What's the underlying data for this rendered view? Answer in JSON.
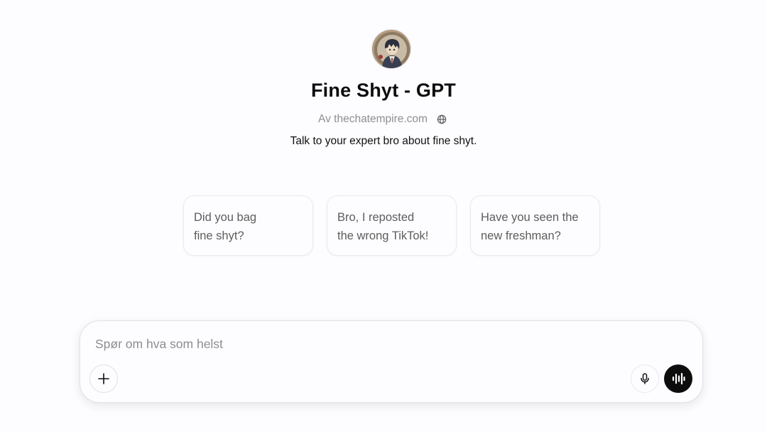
{
  "gpt": {
    "title": "Fine Shyt - GPT",
    "author": "Av thechatempire.com",
    "description": "Talk to your expert bro about fine shyt."
  },
  "suggestions": [
    {
      "line1": "Did you bag",
      "line2": "fine shyt?"
    },
    {
      "line1": "Bro, I reposted",
      "line2": "the wrong TikTok!"
    },
    {
      "line1": "Have you seen the",
      "line2": "new freshman?"
    }
  ],
  "composer": {
    "placeholder": "Spør om hva som helst",
    "value": ""
  },
  "icons": {
    "avatar": "anime-character-avatar",
    "author_badge": "globe-icon",
    "add": "plus-icon",
    "dictate": "microphone-icon",
    "voice_mode": "voice-waveform-icon"
  },
  "colors": {
    "background": "#fdfcfe",
    "voice_button": "#0d0d0d",
    "muted_text": "#8f8f8f"
  }
}
